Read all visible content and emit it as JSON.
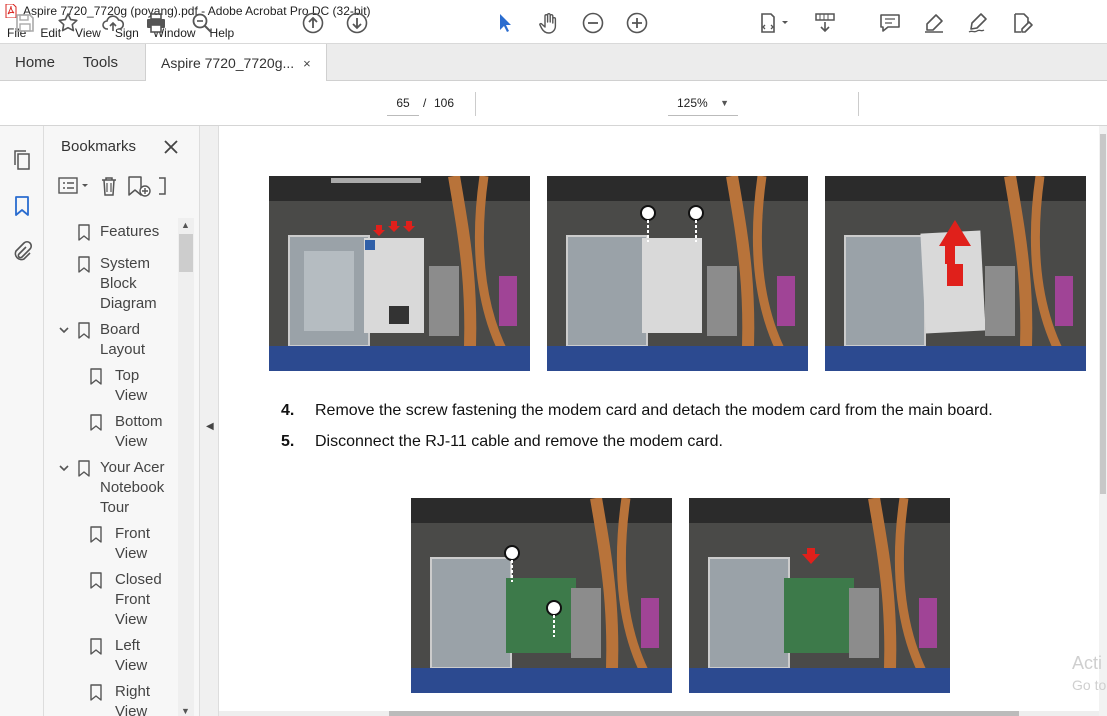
{
  "window": {
    "title": "Aspire 7720_7720g (poyang).pdf - Adobe Acrobat Pro DC (32-bit)"
  },
  "menu": [
    "File",
    "Edit",
    "View",
    "Sign",
    "Window",
    "Help"
  ],
  "tabs": {
    "home": "Home",
    "tools": "Tools",
    "document": "Aspire 7720_7720g...",
    "close": "×"
  },
  "toolbar": {
    "current_page": "65",
    "separator": "/",
    "total_pages": "106",
    "zoom": "125%"
  },
  "bookmarks": {
    "title": "Bookmarks",
    "items": [
      {
        "label_lines": [
          "Features"
        ]
      },
      {
        "label_lines": [
          "System",
          "Block",
          "Diagram"
        ]
      },
      {
        "label_lines": [
          "Board",
          "Layout"
        ],
        "expanded": true
      },
      {
        "label_lines": [
          "Top",
          "View"
        ]
      },
      {
        "label_lines": [
          "Bottom",
          "View"
        ]
      },
      {
        "label_lines": [
          "Your Acer",
          "Notebook",
          "Tour"
        ],
        "expanded": true
      },
      {
        "label_lines": [
          "Front",
          "View"
        ]
      },
      {
        "label_lines": [
          "Closed",
          "Front",
          "View"
        ]
      },
      {
        "label_lines": [
          "Left",
          "View"
        ]
      },
      {
        "label_lines": [
          "Right",
          "View"
        ]
      }
    ]
  },
  "document": {
    "steps": [
      {
        "number": "4.",
        "text": "Remove the screw fastening the modem card and detach the modem card from the main board."
      },
      {
        "number": "5.",
        "text": "Disconnect the RJ-11 cable and remove the modem card."
      }
    ]
  },
  "watermark": {
    "line1": "Acti",
    "line2": "Go to"
  },
  "colors": {
    "accent_blue": "#2a6ccf",
    "arrow_red": "#e0201b",
    "card_green": "#3d7a4a",
    "copper": "#b8733a"
  }
}
